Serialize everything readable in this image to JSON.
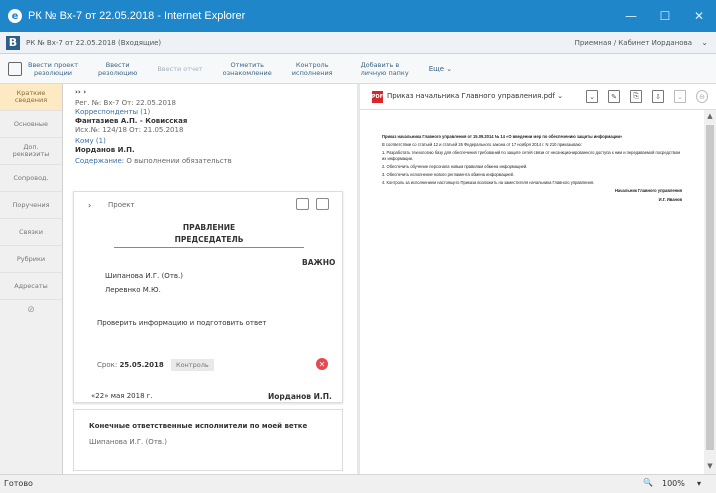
{
  "window": {
    "title": "РК № Вх-7 от 22.05.2018 - Internet Explorer",
    "minimize_icon": "—",
    "maximize_icon": "☐",
    "close_icon": "✕"
  },
  "app": {
    "logo": "B",
    "doc_title": "РК № Вх-7 от 22.05.2018 (Входящие)",
    "user": "Приемная / Кабинет Иорданова",
    "user_chevron": "⌄"
  },
  "toolbar": {
    "buttons": [
      {
        "label": "Ввести проект\nрезолюции"
      },
      {
        "label": "Ввести\nрезолюцию"
      },
      {
        "label": "Ввести отчет"
      },
      {
        "label": "Отметить\nознакомление"
      },
      {
        "label": "Контроль\nисполнения"
      },
      {
        "label": "Добавить в\nличную папку"
      },
      {
        "label": "Еще ⌄"
      }
    ]
  },
  "sidebar": {
    "items": [
      {
        "label": "Краткие\nсведения"
      },
      {
        "label": "Основные"
      },
      {
        "label": "Доп.\nреквизиты"
      },
      {
        "label": "Сопровод."
      },
      {
        "label": "Поручения"
      },
      {
        "label": "Связки"
      },
      {
        "label": "Рубрики"
      },
      {
        "label": "Адресаты"
      }
    ],
    "more": "⊘"
  },
  "card": {
    "header": "›› ›",
    "reg": "Рег. №: Вх-7   От: 22.05.2018",
    "correspondents_label": "Корреспонденты (1)",
    "correspondent": "Фантазиев А.П. - Ковисская",
    "outgoing": "Исх.№: 124/18   От: 21.05.2018",
    "to_label": "Кому (1)",
    "to": "Иорданов И.П.",
    "content_label": "Содержание:",
    "content": "О выполнении обязательств"
  },
  "resolution": {
    "toggle": "›",
    "type": "Проект",
    "dept1": "ПРАВЛЕНИЕ",
    "dept2": "ПРЕДСЕДАТЕЛЬ",
    "important": "ВАЖНО",
    "executors": [
      "Шипанова И.Г. (Отв.)",
      "Леревнко М.Ю."
    ],
    "text": "Проверить информацию и подготовить ответ",
    "deadline_label": "Срок:",
    "deadline": "25.05.2018",
    "control": "Контроль",
    "date": "«22» мая 2018 г.",
    "signer": "Иорданов И.П."
  },
  "final": {
    "title": "Конечные ответственные исполнители по моей ветке",
    "executor": "Шипанова И.Г. (Отв.)"
  },
  "viewer": {
    "file_name": "Приказ начальника Главного управления.pdf ⌄",
    "pdf_icon": "PDF",
    "tools": [
      "⌄",
      "✎",
      "⎘",
      "⇩",
      "⌄",
      "⊖"
    ],
    "pdf_text": {
      "title": "Приказ начальника Главного управления от 15.09.2014 № 14 «О введении мер по обеспечению защиты информации»",
      "intro": "В соответствии со статьей 12 и статьей 26 Федерального закона от 17 ноября 2014 г. N 210 приказываю:",
      "items": [
        "1. Разработать технологию базу для обеспечения требований по защите сетей связи от несанкционированного доступа к ним и передаваемой посредством их информации.",
        "2. Обеспечить обучение персонала новым правилам обмена информацией.",
        "3. Обеспечить исполнение нового регламента обмена информацией.",
        "4. Контроль за исполнением настоящего Приказа возложить на заместителя начальника Главного управления."
      ],
      "sign_title": "Начальник Главного управления",
      "sign_name": "И.Г. Иванов"
    }
  },
  "statusbar": {
    "status": "Готово",
    "zoom": "100%",
    "zoom_icon": "🔍",
    "zoom_chevron": "▾"
  }
}
